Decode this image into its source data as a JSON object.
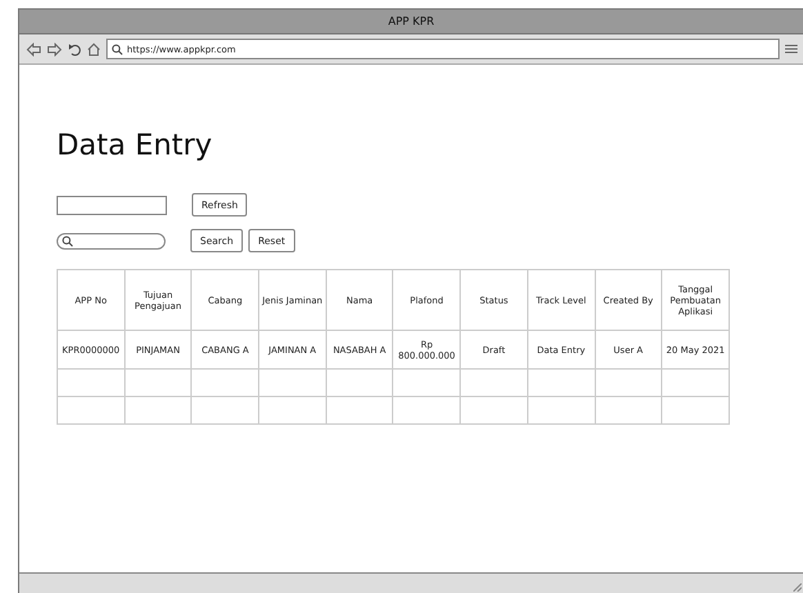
{
  "window": {
    "title": "APP KPR"
  },
  "browser": {
    "url": "https://www.appkpr.com"
  },
  "page": {
    "heading": "Data Entry"
  },
  "filter": {
    "buttons": [
      "Refresh"
    ]
  },
  "search": {
    "buttons": [
      "Search",
      "Reset"
    ]
  },
  "table": {
    "columns": [
      "APP No",
      "Tujuan Pengajuan",
      "Cabang",
      "Jenis Jaminan",
      "Nama",
      "Plafond",
      "Status",
      "Track Level",
      "Created By",
      "Tanggal Pembuatan Aplikasi"
    ],
    "rows": [
      [
        "KPR0000000",
        "PINJAMAN",
        "CABANG A",
        "JAMINAN A",
        "NASABAH A",
        "Rp 800.000.000",
        "Draft",
        "Data Entry",
        "User A",
        "20 May 2021"
      ],
      [
        "",
        "",
        "",
        "",
        "",
        "",
        "",
        "",
        "",
        ""
      ],
      [
        "",
        "",
        "",
        "",
        "",
        "",
        "",
        "",
        "",
        ""
      ]
    ]
  }
}
